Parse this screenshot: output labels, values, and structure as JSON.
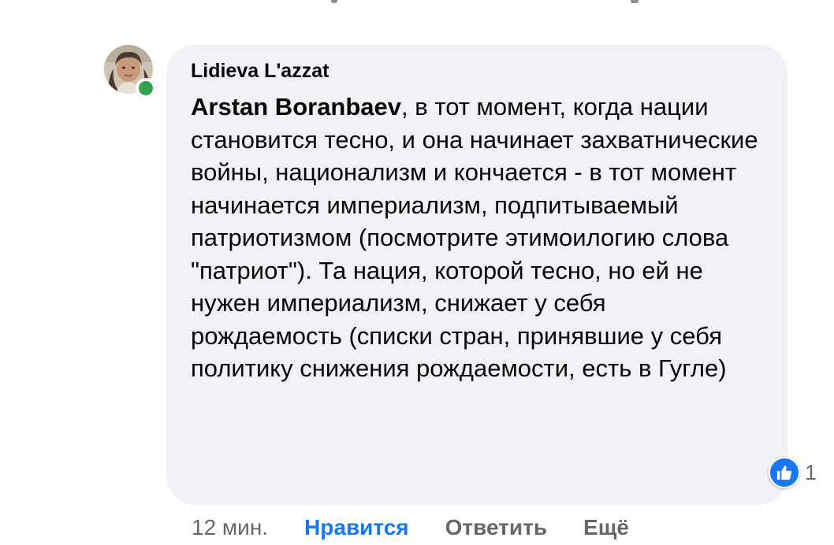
{
  "comment": {
    "author": "Lidieva L'azzat",
    "mention": "Arstan Boranbaev",
    "body": ", в тот момент, когда нации становится тесно, и она начинает захватнические войны, национализм и кончается - в тот момент начинается империализм, подпитываемый патриотизмом (посмотрите этимоилогию слова \"патриот\"). Та нация, которой тесно, но ей не нужен империализм, снижает у себя рождаемость (списки стран, принявшие у себя политику снижения рождаемости, есть в Гугле)",
    "online": true
  },
  "reaction": {
    "icon": "like-icon",
    "count": "1",
    "color": "#1877f2"
  },
  "actions": {
    "time": "12 мин.",
    "like_label": "Нравится",
    "reply_label": "Ответить",
    "more_label": "Ещё"
  },
  "colors": {
    "bubble": "#f0f2f5",
    "accent": "#1877f2",
    "secondary_text": "#65676b",
    "online": "#31a24c"
  }
}
